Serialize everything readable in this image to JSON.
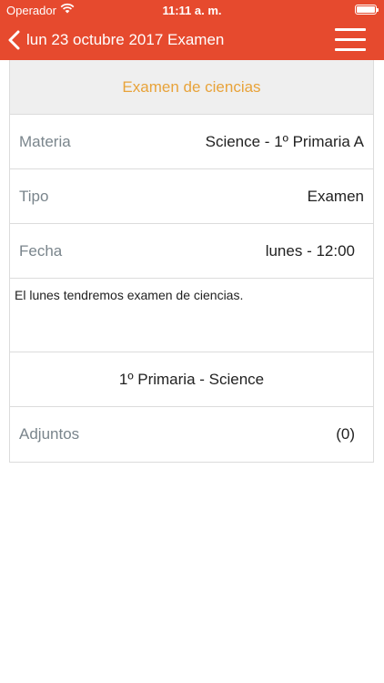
{
  "status_bar": {
    "carrier": "Operador",
    "time": "11:11 a. m."
  },
  "nav": {
    "back_label": "lun 23 octubre 2017",
    "title": "Examen"
  },
  "detail": {
    "header": "Examen de ciencias",
    "rows": [
      {
        "label": "Materia",
        "value": "Science - 1º Primaria A"
      },
      {
        "label": "Tipo",
        "value": "Examen"
      },
      {
        "label": "Fecha",
        "value": "lunes - 12:00"
      }
    ],
    "description": "El lunes tendremos examen de ciencias.",
    "group": "1º Primaria - Science",
    "attachments": {
      "label": "Adjuntos",
      "count": "(0)"
    }
  },
  "colors": {
    "bar": "#e64a2e",
    "header_text": "#e8a33a",
    "label_text": "#7a858c"
  }
}
